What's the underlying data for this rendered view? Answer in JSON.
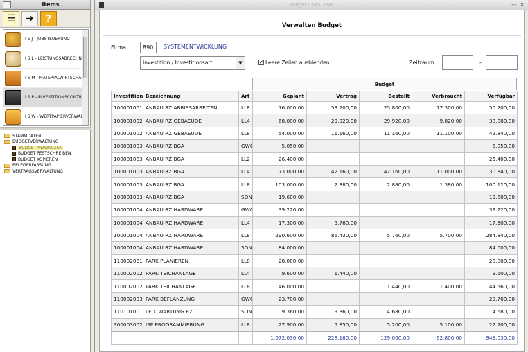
{
  "left_panel": {
    "title": "Items",
    "toolbar": [
      {
        "icon": "tree-icon",
        "glyph": "☰"
      },
      {
        "icon": "arrow-folder-icon",
        "glyph": "➜"
      },
      {
        "icon": "help-icon",
        "glyph": "?"
      }
    ],
    "modules": [
      {
        "label": "I S J - JOBSTEUERUNG",
        "icon": "coins-icon"
      },
      {
        "label": "I S L - LEISTUNGSABRECHNUNG",
        "icon": "money-bag-icon"
      },
      {
        "label": "I S M - MATERIALWIRTSCHAFT",
        "icon": "box-icon"
      },
      {
        "label": "I S P - INVESTITIONSCONTROLLING",
        "icon": "monitor-icon",
        "selected": true
      },
      {
        "label": "I S W - WERTPAPIERVERWALTUNG",
        "icon": "stack-icon"
      }
    ],
    "tree": [
      {
        "label": "STAMMDATEN",
        "type": "folder",
        "level": 0
      },
      {
        "label": "BUDGETVERWALTUNG",
        "type": "folder",
        "level": 0
      },
      {
        "label": "BUDGET VERWALTEN",
        "type": "doc",
        "level": 1,
        "highlighted": true
      },
      {
        "label": "BUDGET FESTSCHREIBEN",
        "type": "doc",
        "level": 1
      },
      {
        "label": "BUDGET KOPIEREN",
        "type": "doc",
        "level": 1
      },
      {
        "label": "BELEGERFASSUNG",
        "type": "folder",
        "level": 0
      },
      {
        "label": "VERTRAGSVERWALTUNG",
        "type": "folder",
        "level": 0
      }
    ]
  },
  "window": {
    "title": "Budget - SYSTEMS",
    "page_title": "Verwalten Budget"
  },
  "form": {
    "firma_label": "Firma",
    "firma_value": "890",
    "firma_name": "SYSTEMENTWICKLUNG",
    "select_value": "Investition / Investitionsart",
    "checkbox_label": "Leere Zeilen ausblenden",
    "checkbox_checked": true,
    "zeitraum_label": "Zeitraum",
    "zeitraum_from": "",
    "zeitraum_sep": "-",
    "zeitraum_to": ""
  },
  "table": {
    "group_header": "Budget",
    "columns": [
      "Investition",
      "Bezeichnung",
      "Art",
      "Geplant",
      "Vertrag",
      "Bestellt",
      "Verbraucht",
      "Verfügbar"
    ],
    "rows": [
      [
        "100001001",
        "ANBAU RZ ABRISSARBEITEN",
        "LL8",
        "76.000,00",
        "53.200,00",
        "25.800,00",
        "17.300,00",
        "50.200,00"
      ],
      [
        "100001002",
        "ANBAU RZ GEBAEUDE",
        "LL4",
        "68.000,00",
        "29.920,00",
        "29.920,00",
        "9.820,00",
        "38.080,00"
      ],
      [
        "100001002",
        "ANBAU RZ GEBAEUDE",
        "LL8",
        "54.000,00",
        "11.160,00",
        "11.160,00",
        "11.100,00",
        "42.840,00"
      ],
      [
        "100001003",
        "ANBAU RZ BGA",
        "GWG",
        "5.050,00",
        "",
        "",
        "",
        "5.050,00"
      ],
      [
        "100001003",
        "ANBAU RZ BGA",
        "LL2",
        "26.400,00",
        "",
        "",
        "",
        "26.400,00"
      ],
      [
        "100001003",
        "ANBAU RZ BGA",
        "LL4",
        "73.000,00",
        "42.160,00",
        "42.160,00",
        "11.000,00",
        "30.840,00"
      ],
      [
        "100001003",
        "ANBAU RZ BGA",
        "LL8",
        "103.000,00",
        "2.880,00",
        "2.880,00",
        "1.380,00",
        "100.120,00"
      ],
      [
        "100001003",
        "ANBAU RZ BGA",
        "SON",
        "19.600,00",
        "",
        "",
        "",
        "19.600,00"
      ],
      [
        "100001004",
        "ANBAU RZ HARDWARE",
        "GWG",
        "39.220,00",
        "",
        "",
        "",
        "39.220,00"
      ],
      [
        "100001004",
        "ANBAU RZ HARDWARE",
        "LL4",
        "17.300,00",
        "5.760,00",
        "",
        "",
        "17.300,00"
      ],
      [
        "100001004",
        "ANBAU RZ HARDWARE",
        "LL8",
        "290.600,00",
        "86.430,00",
        "5.760,00",
        "5.700,00",
        "284.840,00"
      ],
      [
        "100001004",
        "ANBAU RZ HARDWARE",
        "SON",
        "84.000,00",
        "",
        "",
        "",
        "84.000,00"
      ],
      [
        "110002001",
        "PARK PLANIEREN",
        "LL8",
        "28.000,00",
        "",
        "",
        "",
        "28.000,00"
      ],
      [
        "110002002",
        "PARK TEICHANLAGE",
        "LL4",
        "9.600,00",
        "1.440,00",
        "",
        "",
        "9.600,00"
      ],
      [
        "110002002",
        "PARK TEICHANLAGE",
        "LL8",
        "46.000,00",
        "",
        "1.440,00",
        "1.400,00",
        "44.560,00"
      ],
      [
        "110002003",
        "PARK BEFLANZUNG",
        "GWG",
        "23.700,00",
        "",
        "",
        "",
        "23.700,00"
      ],
      [
        "110101001",
        "LFD. WARTUNG RZ",
        "SON",
        "9.360,00",
        "9.360,00",
        "4.680,00",
        "",
        "4.680,00"
      ],
      [
        "300003002",
        "ISP PROGRAMMIERUNG",
        "LL8",
        "27.900,00",
        "5.850,00",
        "5.200,00",
        "5.100,00",
        "22.700,00"
      ]
    ],
    "totals": [
      "",
      "",
      "",
      "1.072.030,00",
      "228.160,00",
      "129.000,00",
      "62.800,00",
      "943.030,00"
    ]
  }
}
